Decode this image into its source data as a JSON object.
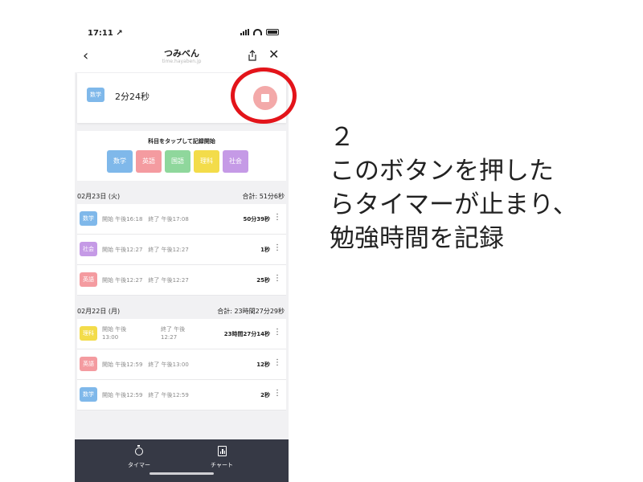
{
  "status_bar": {
    "time": "17:11 ↗"
  },
  "nav": {
    "back_label": "‹",
    "title": "つみべん",
    "subtitle": "time.hayaben.jp",
    "close_label": "✕"
  },
  "timer": {
    "subject": "数学",
    "elapsed": "2分24秒"
  },
  "picker": {
    "hint": "科目をタップして記録開始",
    "subjects": [
      {
        "label": "数学",
        "color": "#7fb8ea"
      },
      {
        "label": "英語",
        "color": "#f49ba0"
      },
      {
        "label": "国語",
        "color": "#8fd79c"
      },
      {
        "label": "理科",
        "color": "#f3dc4a"
      },
      {
        "label": "社会",
        "color": "#c59ae6"
      }
    ]
  },
  "days": [
    {
      "date": "02月23日 (火)",
      "total": "合計: 51分6秒",
      "records": [
        {
          "subject": "数学",
          "color": "#7fb8ea",
          "time": "開始 午後16:18　終了 午後17:08",
          "duration": "50分39秒"
        },
        {
          "subject": "社会",
          "color": "#c59ae6",
          "time": "開始 午後12:27　終了 午後12:27",
          "duration": "1秒"
        },
        {
          "subject": "英語",
          "color": "#f49ba0",
          "time": "開始 午後12:27　終了 午後12:27",
          "duration": "25秒"
        }
      ]
    },
    {
      "date": "02月22日 (月)",
      "total": "合計: 23時間27分29秒",
      "records": [
        {
          "subject": "理科",
          "color": "#f3dc4a",
          "start": "開始 午後 13:00",
          "end": "終了 午後 12:27",
          "duration": "23時間27分14秒"
        },
        {
          "subject": "英語",
          "color": "#f49ba0",
          "time": "開始 午後12:59　終了 午後13:00",
          "duration": "12秒"
        },
        {
          "subject": "数学",
          "color": "#7fb8ea",
          "time": "開始 午後12:59　終了 午後12:59",
          "duration": "2秒"
        }
      ]
    }
  ],
  "more_label": "⋮",
  "tabs": [
    {
      "label": "タイマー",
      "icon": "timer-icon"
    },
    {
      "label": "チャート",
      "icon": "chart-icon"
    }
  ],
  "annotation": {
    "lines": [
      "２",
      "このボタンを押した",
      "らタイマーが止まり、",
      "勉強時間を記録"
    ],
    "color": "#e3141a"
  }
}
